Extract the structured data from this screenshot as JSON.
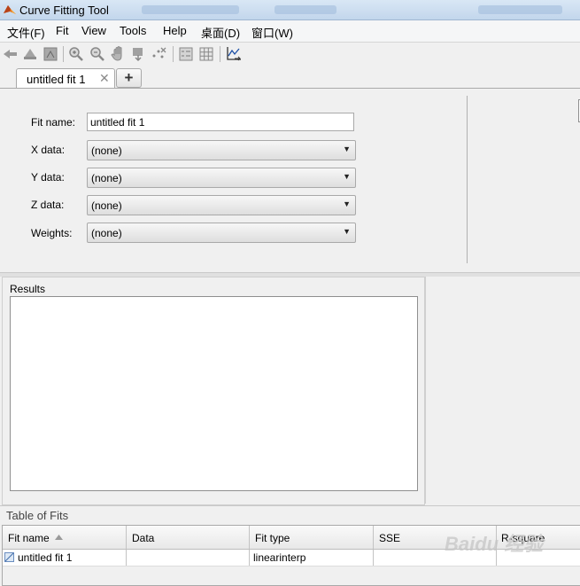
{
  "window": {
    "title": "Curve Fitting Tool"
  },
  "menu": {
    "items": [
      "文件(F)",
      "Fit",
      "View",
      "Tools",
      "Help",
      "桌面(D)",
      "窗口(W)"
    ]
  },
  "toolbar": {
    "icons": [
      "pan-left-icon",
      "pan-arrow-icon",
      "data-cursor-icon",
      "zoom-in-icon",
      "zoom-out-icon",
      "pan-hand-icon",
      "data-cursor-down-icon",
      "exclude-outliers-icon",
      "legend-icon",
      "grid-icon",
      "axes-limits-icon"
    ]
  },
  "tabs": {
    "items": [
      {
        "label": "untitled fit 1"
      }
    ],
    "add_label": "+"
  },
  "fit_panel": {
    "fit_name_label": "Fit name:",
    "fit_name_value": "untitled fit 1",
    "x_label": "X data:",
    "x_value": "(none)",
    "y_label": "Y data:",
    "y_value": "(none)",
    "z_label": "Z data:",
    "z_value": "(none)",
    "weights_label": "Weights:",
    "weights_value": "(none)"
  },
  "results": {
    "title": "Results"
  },
  "table_of_fits": {
    "title": "Table of Fits",
    "columns": [
      "Fit name",
      "Data",
      "Fit type",
      "SSE",
      "R-square"
    ],
    "rows": [
      {
        "fit_name": "untitled fit 1",
        "data": "",
        "fit_type": "linearinterp",
        "sse": "",
        "r_square": ""
      }
    ]
  },
  "watermark": {
    "text": "Baidu 经验"
  }
}
